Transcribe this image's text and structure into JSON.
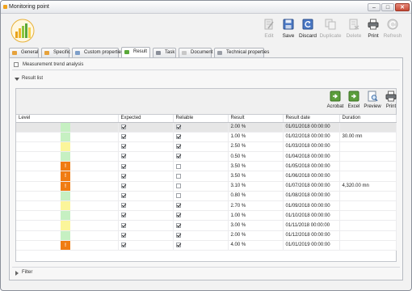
{
  "window": {
    "title": "Monitoring point"
  },
  "toolbar": {
    "buttons": [
      {
        "label": "Edit",
        "icon": "edit-icon",
        "enabled": false
      },
      {
        "label": "Save",
        "icon": "save-icon",
        "enabled": true
      },
      {
        "label": "Discard",
        "icon": "discard-icon",
        "enabled": true
      },
      {
        "label": "Duplicate",
        "icon": "duplicate-icon",
        "enabled": false
      },
      {
        "label": "Delete",
        "icon": "delete-icon",
        "enabled": false
      },
      {
        "label": "Print",
        "icon": "print-icon",
        "enabled": true
      },
      {
        "label": "Refresh",
        "icon": "refresh-icon",
        "enabled": false
      }
    ]
  },
  "tabs": [
    {
      "label": "General",
      "active": false
    },
    {
      "label": "Specific",
      "active": false
    },
    {
      "label": "Custom properties",
      "active": false
    },
    {
      "label": "Result",
      "active": true
    },
    {
      "label": "Task",
      "active": false
    },
    {
      "label": "Document",
      "active": false
    },
    {
      "label": "Technical properties",
      "active": false
    }
  ],
  "section": {
    "title": "Measurement trend analysis"
  },
  "result_list": {
    "title": "Result list"
  },
  "export": {
    "buttons": [
      {
        "label": "Acrobat",
        "icon": "acrobat-icon"
      },
      {
        "label": "Excel",
        "icon": "excel-icon"
      },
      {
        "label": "Preview",
        "icon": "preview-icon"
      },
      {
        "label": "Print",
        "icon": "print-icon"
      }
    ]
  },
  "table": {
    "columns": [
      "Level",
      "Expected",
      "Reliable",
      "Result",
      "Result date",
      "Duration"
    ],
    "rows": [
      {
        "level": "green",
        "expected": true,
        "reliable": true,
        "result": "2.00 %",
        "date": "01/01/2018 00:00:00",
        "duration": ""
      },
      {
        "level": "green",
        "expected": true,
        "reliable": true,
        "result": "1.00 %",
        "date": "01/02/2018 00:00:00",
        "duration": "30.00 mn"
      },
      {
        "level": "yellow",
        "expected": true,
        "reliable": true,
        "result": "2.50 %",
        "date": "01/03/2018 00:00:00",
        "duration": ""
      },
      {
        "level": "green",
        "expected": true,
        "reliable": true,
        "result": "0.50 %",
        "date": "01/04/2018 00:00:00",
        "duration": ""
      },
      {
        "level": "orange",
        "expected": true,
        "reliable": false,
        "result": "3.50 %",
        "date": "01/05/2018 00:00:00",
        "duration": ""
      },
      {
        "level": "orange",
        "expected": true,
        "reliable": false,
        "result": "3.50 %",
        "date": "01/06/2018 00:00:00",
        "duration": ""
      },
      {
        "level": "orange",
        "expected": true,
        "reliable": false,
        "result": "3.10 %",
        "date": "01/07/2018 00:00:00",
        "duration": "4,320.00 mn"
      },
      {
        "level": "green",
        "expected": true,
        "reliable": false,
        "result": "0.80 %",
        "date": "01/08/2018 00:00:00",
        "duration": ""
      },
      {
        "level": "yellow",
        "expected": true,
        "reliable": true,
        "result": "2.70 %",
        "date": "01/09/2018 00:00:00",
        "duration": ""
      },
      {
        "level": "green",
        "expected": true,
        "reliable": true,
        "result": "1.00 %",
        "date": "01/10/2018 00:00:00",
        "duration": ""
      },
      {
        "level": "yellow",
        "expected": true,
        "reliable": true,
        "result": "3.00 %",
        "date": "01/11/2018 00:00:00",
        "duration": ""
      },
      {
        "level": "green",
        "expected": true,
        "reliable": true,
        "result": "2.00 %",
        "date": "01/12/2018 00:00:00",
        "duration": ""
      },
      {
        "level": "orange",
        "expected": true,
        "reliable": true,
        "result": "4.00 %",
        "date": "01/01/2019 00:00:00",
        "duration": ""
      }
    ],
    "selected_row": 0
  },
  "filter": {
    "title": "Filter"
  },
  "colors": {
    "green": "#c6f0c2",
    "yellow": "#fbf59a",
    "orange": "#f07c12",
    "accent": "#2a6fc0"
  }
}
